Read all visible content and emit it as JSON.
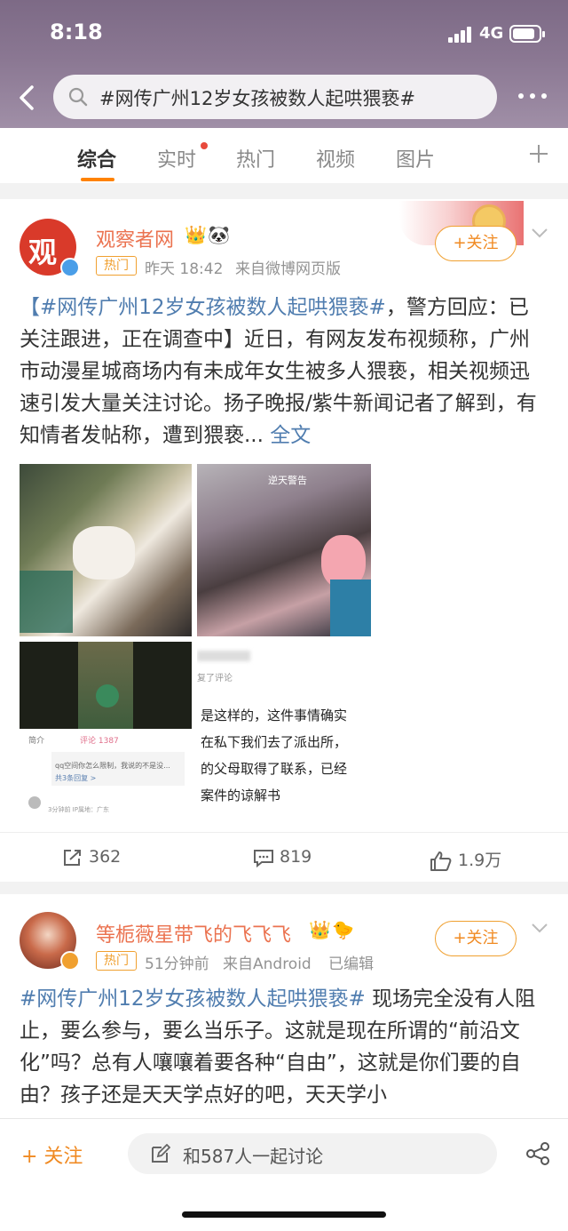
{
  "status_bar": {
    "time": "8:18",
    "network": "4G"
  },
  "search": {
    "query": "#网传广州12岁女孩被数人起哄猥亵#"
  },
  "tabs": [
    {
      "label": "综合",
      "active": true
    },
    {
      "label": "实时",
      "active": false
    },
    {
      "label": "热门",
      "active": false
    },
    {
      "label": "视频",
      "active": false
    },
    {
      "label": "图片",
      "active": false
    }
  ],
  "posts": [
    {
      "author": "观察者网",
      "badge": "热门",
      "time": "昨天 18:42",
      "source": "来自微博网页版",
      "follow_label": "+关注",
      "hashtag": "【#网传广州12岁女孩被数人起哄猥亵#",
      "body": "，警方回应：已关注跟进，正在调查中】近日，有网友发布视频称，广州市动漫星城商场内有未成年女生被多人猥亵，相关视频迅速引发大量关注讨论。扬子晚报/紫牛新闻记者了解到，有知情者发帖称，遭到猥亵...",
      "full_text_label": "全文",
      "images": {
        "overlay_text_1": "逆天警告",
        "screenshot_tabs": [
          "简介",
          "评论 1387"
        ],
        "screenshot_comment": "qq空间你怎么限制，我说的不是没...",
        "screenshot_reply_count": "共3条回复 >",
        "screenshot_meta": "3分钟前 IP属地：广东",
        "screenshot_reply_header": "复了评论",
        "screenshot_lines": [
          "是这样的，这件事情确实",
          "在私下我们去了派出所，",
          "的父母取得了联系，已经",
          "案件的谅解书"
        ]
      },
      "reposts": "362",
      "comments": "819",
      "likes": "1.9万"
    },
    {
      "author": "等栀薇星带飞的飞飞飞",
      "badge": "热门",
      "time": "51分钟前",
      "source": "来自Android",
      "edited": "已编辑",
      "follow_label": "+关注",
      "hashtag": "#网传广州12岁女孩被数人起哄猥亵#",
      "body": " 现场完全没有人阻止，要么参与，要么当乐子。这就是现在所谓的“前沿文化”吗？总有人嚷嚷着要各种“自由”，这就是你们要的自由？孩子还是天天学点好的吧，天天学小"
    }
  ],
  "bottom_bar": {
    "follow_label": "+ 关注",
    "discuss_label": "和587人一起讨论"
  },
  "colors": {
    "accent": "#ff8200",
    "link": "#507daf",
    "name": "#eb7350",
    "header": "#7d6a86"
  }
}
